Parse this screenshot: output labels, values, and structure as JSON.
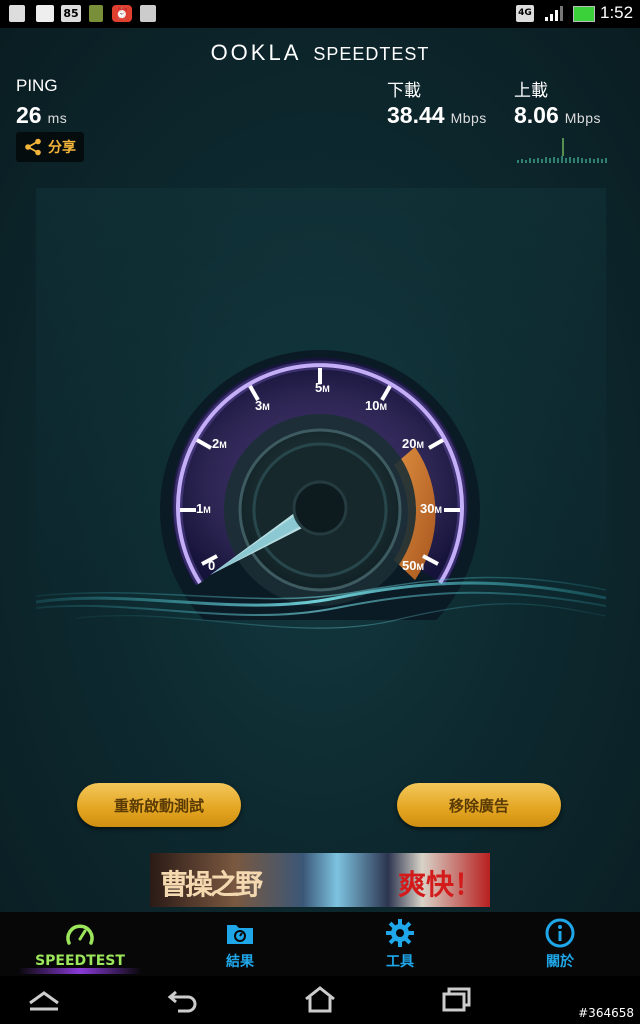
{
  "status_bar": {
    "badge_number": "85",
    "network": "4G",
    "time": "1:52"
  },
  "header": {
    "brand_ookla": "OOKLA",
    "brand_speedtest": "SPEEDTEST"
  },
  "metrics": {
    "ping_label": "PING",
    "ping_value": "26",
    "ping_unit": "ms",
    "download_label": "下載",
    "download_value": "38.44",
    "download_unit": "Mbps",
    "upload_label": "上載",
    "upload_value": "8.06",
    "upload_unit": "Mbps"
  },
  "share": {
    "label": "分享"
  },
  "gauge": {
    "ticks": [
      "0",
      "1M",
      "2M",
      "3M",
      "5M",
      "10M",
      "20M",
      "30M",
      "50M"
    ],
    "accent": "#e8862a",
    "needle_value": 0
  },
  "buttons": {
    "restart": "重新啟動測試",
    "remove_ads": "移除廣告"
  },
  "ad": {
    "text_left": "曹操之野",
    "text_right": "爽快！"
  },
  "tabs": [
    {
      "label": "SPEEDTEST",
      "icon": "gauge-icon"
    },
    {
      "label": "結果",
      "icon": "results-folder-icon"
    },
    {
      "label": "工具",
      "icon": "gear-icon"
    },
    {
      "label": "關於",
      "icon": "info-icon"
    }
  ],
  "watermark": "#364658",
  "colors": {
    "accent_gold": "#e3a521",
    "tab_blue": "#1fa7ea",
    "tab_active": "#9be65a"
  }
}
